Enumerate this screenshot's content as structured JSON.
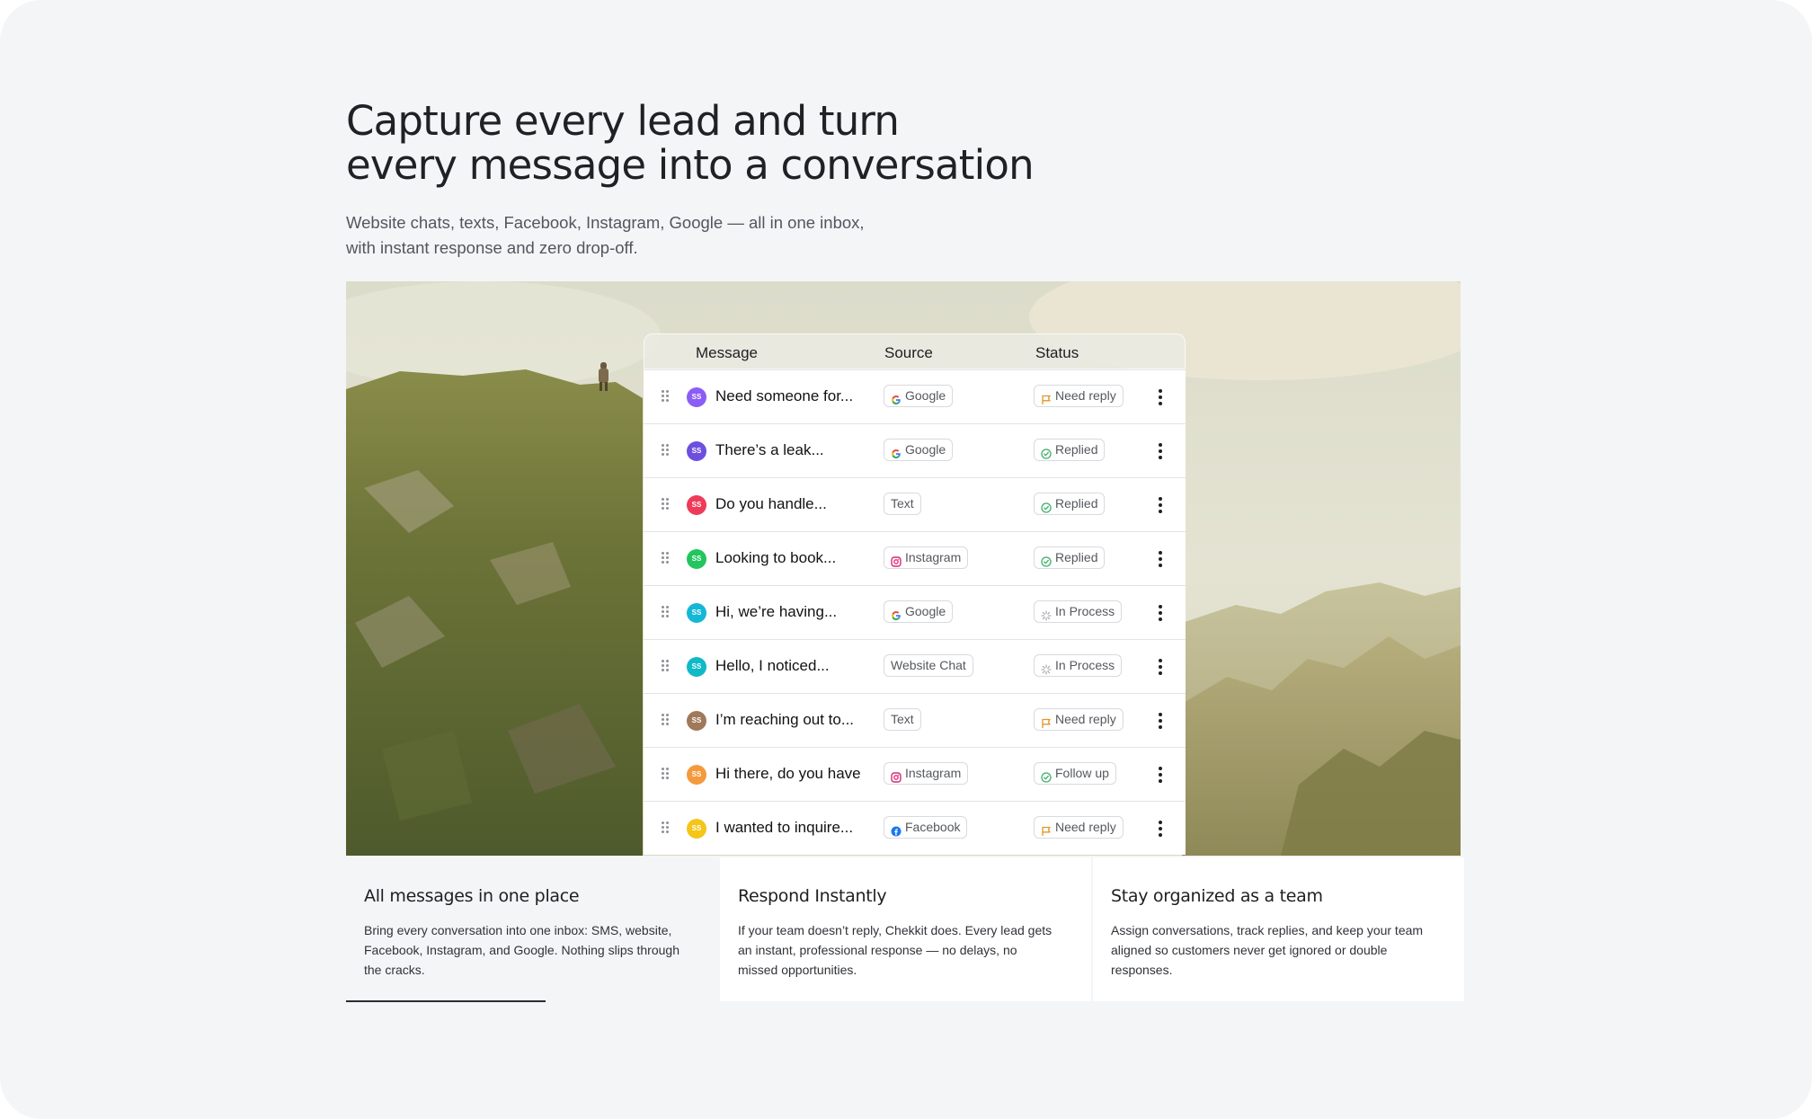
{
  "hero": {
    "title_line1": "Capture every lead and turn",
    "title_line2": "every message into a conversation",
    "subtitle_line1": "Website chats, texts, Facebook, Instagram, Google — all in one inbox,",
    "subtitle_line2": "with instant response and zero drop-off."
  },
  "inbox": {
    "columns": {
      "message": "Message",
      "source": "Source",
      "status": "Status"
    },
    "rows": [
      {
        "initials": "SS",
        "avatar_color": "#8b5cf6",
        "message": "Need someone for...",
        "source": "Google",
        "source_icon": "google-icon",
        "status": "Need reply",
        "status_icon": "flag-icon"
      },
      {
        "initials": "SS",
        "avatar_color": "#6d4fe0",
        "message": "There’s a leak...",
        "source": "Google",
        "source_icon": "google-icon",
        "status": "Replied",
        "status_icon": "check-circle-icon"
      },
      {
        "initials": "SS",
        "avatar_color": "#ef3b5a",
        "message": "Do you handle...",
        "source": "Text",
        "source_icon": "",
        "status": "Replied",
        "status_icon": "check-circle-icon"
      },
      {
        "initials": "SS",
        "avatar_color": "#22c55e",
        "message": "Looking to book...",
        "source": "Instagram",
        "source_icon": "instagram-icon",
        "status": "Replied",
        "status_icon": "check-circle-icon"
      },
      {
        "initials": "SS",
        "avatar_color": "#14b8d6",
        "message": "Hi, we’re having...",
        "source": "Google",
        "source_icon": "google-icon",
        "status": "In Process",
        "status_icon": "spinner-icon"
      },
      {
        "initials": "SS",
        "avatar_color": "#10b9c8",
        "message": "Hello, I noticed...",
        "source": "Website Chat",
        "source_icon": "",
        "status": "In Process",
        "status_icon": "spinner-icon"
      },
      {
        "initials": "SS",
        "avatar_color": "#a0785a",
        "message": "I’m reaching out to...",
        "source": "Text",
        "source_icon": "",
        "status": "Need reply",
        "status_icon": "flag-icon"
      },
      {
        "initials": "SS",
        "avatar_color": "#f59a3c",
        "message": "Hi there, do you have",
        "source": "Instagram",
        "source_icon": "instagram-icon",
        "status": "Follow up",
        "status_icon": "check-circle-icon"
      },
      {
        "initials": "SS",
        "avatar_color": "#f5c518",
        "message": "I wanted to inquire...",
        "source": "Facebook",
        "source_icon": "facebook-icon",
        "status": "Need reply",
        "status_icon": "flag-icon"
      }
    ]
  },
  "features": [
    {
      "title": "All messages in one place",
      "body": [
        "Bring every conversation into one inbox: SMS, website,",
        "Facebook, Instagram, and Google. Nothing slips through",
        "the cracks."
      ],
      "active": true
    },
    {
      "title": "Respond Instantly",
      "body": [
        "If your team doesn’t reply, Chekkit does. Every lead gets",
        "an instant, professional response — no delays, no",
        "missed opportunities."
      ],
      "active": false
    },
    {
      "title": "Stay organized as a team",
      "body": [
        "Assign conversations, track replies, and keep your team",
        "aligned so customers never get ignored or double",
        "responses."
      ],
      "active": false
    }
  ],
  "colors": {
    "status_flag": "#e0962a",
    "status_check": "#3fae6a",
    "status_spinner": "#9a9da3",
    "google_blue": "#4285f4",
    "facebook_blue": "#1877f2",
    "instagram_pink": "#d62976"
  }
}
